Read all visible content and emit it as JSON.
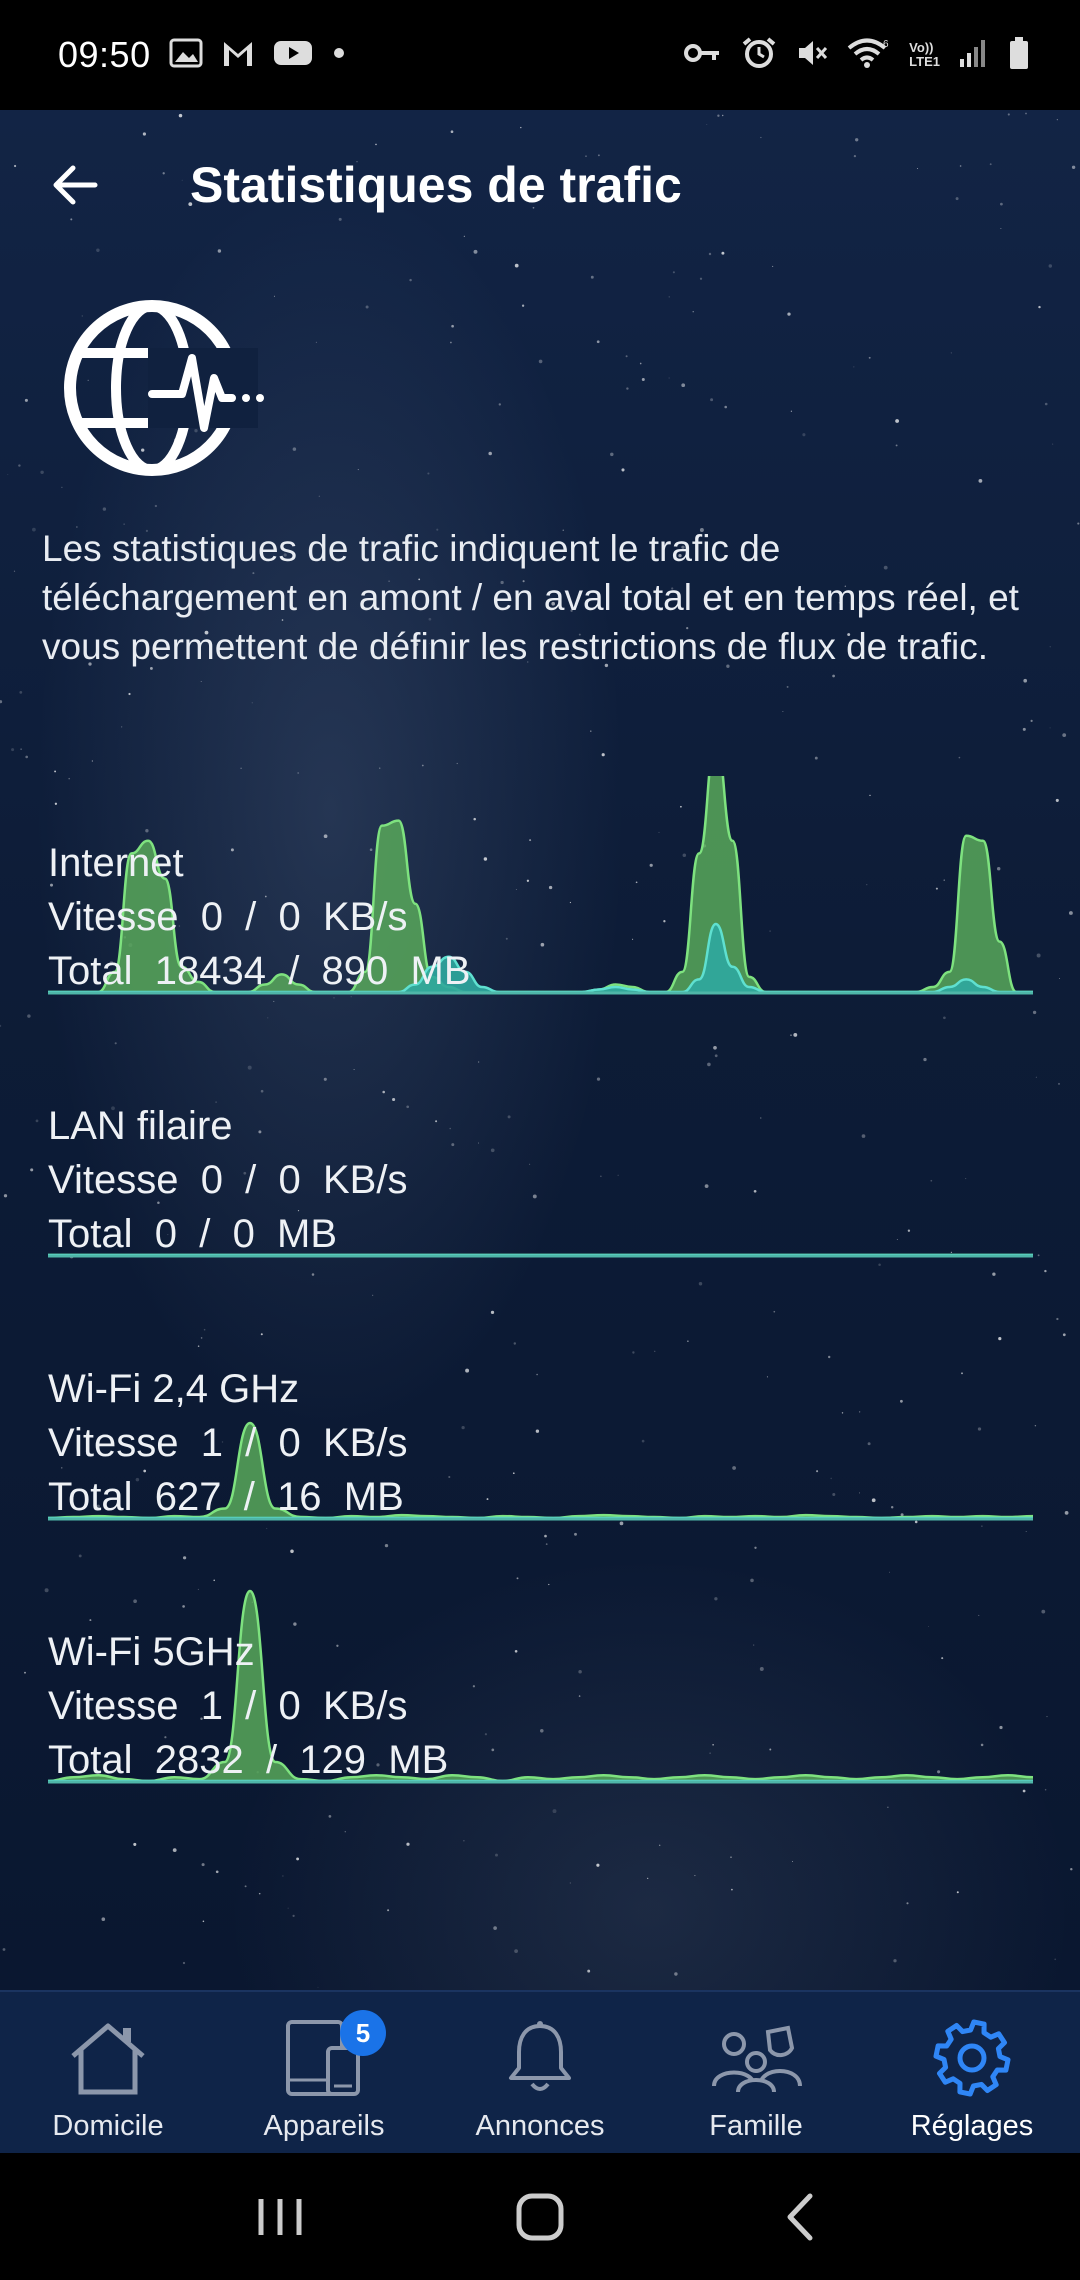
{
  "status_bar": {
    "time": "09:50",
    "left_icons": [
      "image-icon",
      "gmail-icon",
      "youtube-icon",
      "dot-icon"
    ],
    "right_icons": [
      "vpn-key-icon",
      "alarm-icon",
      "mute-icon",
      "wifi-icon",
      "volte-icon",
      "signal-icon",
      "battery-icon"
    ],
    "volte_text_top": "Vo))",
    "volte_text_bottom": "LTE1"
  },
  "header": {
    "title": "Statistiques de trafic",
    "back_icon": "arrow-left-icon"
  },
  "logo_icon": "globe-pulse-icon",
  "description": "Les statistiques de trafic indiquent le trafic de téléchargement en amont / en aval total et en temps réel, et vous permettent de définir les restrictions de flux de trafic.",
  "colors": {
    "upload_fill": "#58a85a",
    "upload_stroke": "#7ee27f",
    "download_fill": "#2fa9a0",
    "download_stroke": "#5fe0d0",
    "accent_blue": "#1a73e8",
    "active_tab": "#2f86f6"
  },
  "stats": [
    {
      "name": "Internet",
      "speed_label": "Vitesse",
      "speed_up": "0",
      "speed_down": "0",
      "speed_unit": "KB/s",
      "total_label": "Total",
      "total_up": "18434",
      "total_down": "890",
      "total_unit": "MB",
      "chart": {
        "upload": [
          0,
          0,
          0,
          0,
          0.08,
          0.55,
          0.6,
          0.45,
          0.1,
          0.04,
          0,
          0,
          0,
          0.03,
          0.07,
          0.03,
          0,
          0,
          0,
          0.08,
          0.66,
          0.68,
          0.35,
          0.06,
          0.02,
          0,
          0,
          0,
          0,
          0,
          0,
          0,
          0,
          0.01,
          0.03,
          0.02,
          0,
          0,
          0.08,
          0.55,
          1.0,
          0.6,
          0.06,
          0,
          0,
          0,
          0,
          0,
          0,
          0,
          0,
          0,
          0,
          0.02,
          0.08,
          0.62,
          0.6,
          0.2,
          0,
          0
        ],
        "download": [
          0,
          0,
          0,
          0,
          0,
          0,
          0,
          0,
          0,
          0,
          0,
          0,
          0,
          0,
          0,
          0,
          0,
          0,
          0,
          0,
          0,
          0,
          0.03,
          0.1,
          0.14,
          0.08,
          0.02,
          0,
          0,
          0,
          0,
          0,
          0,
          0.01,
          0.02,
          0.01,
          0,
          0,
          0,
          0.05,
          0.27,
          0.1,
          0.02,
          0,
          0,
          0,
          0,
          0,
          0,
          0,
          0,
          0,
          0,
          0,
          0.02,
          0.05,
          0.02,
          0,
          0,
          0
        ]
      }
    },
    {
      "name": "LAN filaire",
      "speed_label": "Vitesse",
      "speed_up": "0",
      "speed_down": "0",
      "speed_unit": "KB/s",
      "total_label": "Total",
      "total_up": "0",
      "total_down": "0",
      "total_unit": "MB",
      "chart": {
        "upload": [
          0,
          0,
          0,
          0,
          0,
          0,
          0,
          0,
          0,
          0
        ],
        "download": [
          0,
          0,
          0,
          0,
          0,
          0,
          0,
          0,
          0,
          0
        ]
      }
    },
    {
      "name": "Wi-Fi 2,4 GHz",
      "speed_label": "Vitesse",
      "speed_up": "1",
      "speed_down": "0",
      "speed_unit": "KB/s",
      "total_label": "Total",
      "total_up": "627",
      "total_down": "16",
      "total_unit": "MB",
      "chart": {
        "upload": [
          0,
          0.01,
          0.02,
          0.01,
          0,
          0.02,
          0.01,
          0.1,
          1.0,
          0.1,
          0.01,
          0,
          0.02,
          0.01,
          0.03,
          0.02,
          0.01,
          0,
          0.02,
          0.01,
          0,
          0.02,
          0.03,
          0.02,
          0.01,
          0,
          0.02,
          0.01,
          0.02,
          0.01,
          0.03,
          0.02,
          0.01,
          0,
          0.01,
          0.02,
          0.01,
          0.02,
          0.01,
          0.02
        ],
        "download": [
          0,
          0,
          0,
          0,
          0,
          0,
          0,
          0,
          0,
          0,
          0,
          0,
          0,
          0,
          0,
          0,
          0,
          0,
          0,
          0,
          0,
          0,
          0,
          0,
          0,
          0,
          0,
          0,
          0,
          0,
          0,
          0,
          0,
          0,
          0,
          0,
          0,
          0,
          0,
          0
        ]
      }
    },
    {
      "name": "Wi-Fi 5GHz",
      "speed_label": "Vitesse",
      "speed_up": "1",
      "speed_down": "0",
      "speed_unit": "KB/s",
      "total_label": "Total",
      "total_up": "2832",
      "total_down": "129",
      "total_unit": "MB",
      "chart": {
        "upload": [
          0,
          0.02,
          0.03,
          0.01,
          0,
          0.02,
          0.01,
          0.1,
          1.0,
          0.1,
          0.01,
          0,
          0.02,
          0.03,
          0.02,
          0.01,
          0.03,
          0.02,
          0,
          0.02,
          0.01,
          0.02,
          0.03,
          0.02,
          0.01,
          0.02,
          0.03,
          0.02,
          0.01,
          0.02,
          0.03,
          0.02,
          0.01,
          0.02,
          0.03,
          0.02,
          0.01,
          0.02,
          0.03,
          0.02
        ],
        "download": [
          0,
          0,
          0,
          0,
          0,
          0,
          0,
          0,
          0,
          0,
          0,
          0,
          0,
          0,
          0,
          0,
          0,
          0,
          0,
          0,
          0,
          0,
          0,
          0,
          0,
          0,
          0,
          0,
          0,
          0,
          0,
          0,
          0,
          0,
          0,
          0,
          0,
          0,
          0,
          0
        ]
      }
    }
  ],
  "bottom_nav": [
    {
      "label": "Domicile",
      "icon": "house-icon",
      "active": false
    },
    {
      "label": "Appareils",
      "icon": "devices-icon",
      "badge": "5",
      "active": false
    },
    {
      "label": "Annonces",
      "icon": "bell-icon",
      "active": false
    },
    {
      "label": "Famille",
      "icon": "family-icon",
      "active": false
    },
    {
      "label": "Réglages",
      "icon": "gear-icon",
      "active": true
    }
  ],
  "system_nav": [
    "recents-icon",
    "home-icon",
    "back-icon"
  ]
}
